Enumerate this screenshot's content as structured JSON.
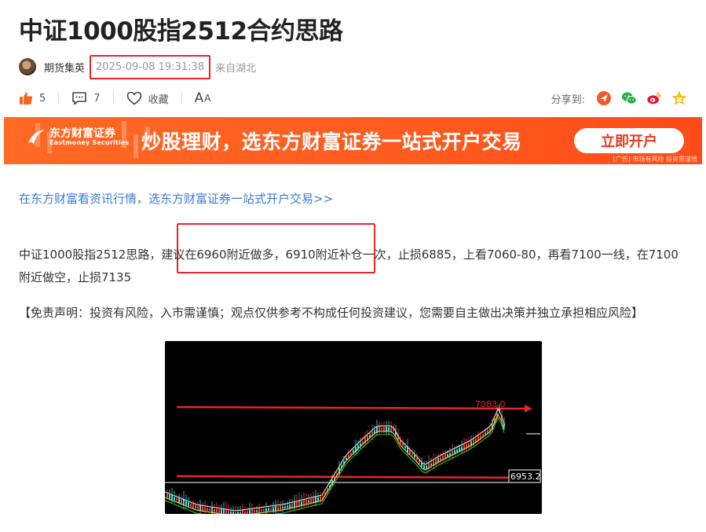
{
  "article": {
    "title": "中证1000股指2512合约思路",
    "author": "期货集英",
    "date": "2025-09-08 19:31:38",
    "source": "来自湖北"
  },
  "actions": {
    "like_count": "5",
    "comment_count": "7",
    "favorite_label": "收藏",
    "font_toggle_big": "A",
    "font_toggle_small": "A",
    "share_label": "分享到:"
  },
  "banner": {
    "logo_cn": "东方财富证券",
    "logo_en": "Eastmoney Securities",
    "slogan": "炒股理财，选东方财富证券一站式开户交易",
    "cta": "立即开户",
    "ad_note": "[广告] 市场有风险 投资需谨慎"
  },
  "promo_link": "在东方财富看资讯行情，选东方财富证券一站式开户交易>>",
  "content": {
    "paragraph": "中证1000股指2512思路，建议在6960附近做多，6910附近补仓一次，止损6885，上看7060-80，再看7100一线，在7100附近做空，止损7135",
    "disclaimer": "【免责声明：投资有风险，入市需谨慎；观点仅供参考不构成任何投资建议，您需要自主做出决策并独立承担相应风险】"
  },
  "chart": {
    "upper_level_label": "7083.0",
    "lower_level_label": "6953.2",
    "colors": {
      "level_line": "#e8262b",
      "price_box_line": "#ffffff",
      "candle_up": "#ff3b3b",
      "candle_down": "#3be0e0",
      "ma_yellow": "#f5e64a",
      "ma_green": "#2ecc40",
      "ma_white": "#e8e8e8"
    }
  },
  "colors": {
    "accent_red": "#e5262b",
    "link_blue": "#3a7bd5",
    "banner_orange": "#ff5a1f"
  },
  "icons": {
    "like": "thumbs-up-icon",
    "comment": "comment-icon",
    "favorite": "heart-icon",
    "font_size": "font-size-icon",
    "share_channels": [
      "toutiao-share-icon",
      "wechat-share-icon",
      "weibo-share-icon",
      "qzone-share-icon"
    ]
  }
}
